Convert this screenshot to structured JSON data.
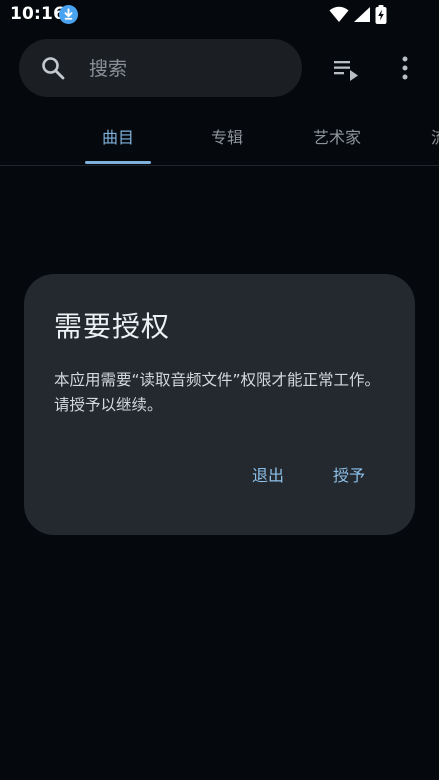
{
  "status_bar": {
    "time": "10:16"
  },
  "search": {
    "placeholder": "搜索"
  },
  "tabs": [
    {
      "label": "曲目",
      "active": true
    },
    {
      "label": "专辑",
      "active": false
    },
    {
      "label": "艺术家",
      "active": false
    },
    {
      "label": "流",
      "active": false
    }
  ],
  "dialog": {
    "title": "需要授权",
    "message": "本应用需要“读取音频文件”权限才能正常工作。请授予以继续。",
    "exit_label": "退出",
    "grant_label": "授予"
  },
  "colors": {
    "background": "#05090d",
    "surface": "#24292f",
    "search_bar": "#1b1f24",
    "accent": "#7fb1dc",
    "download_badge": "#4aa3f0"
  },
  "icons": {
    "status": [
      "download-icon",
      "wifi-icon",
      "cell-signal-icon",
      "battery-charging-icon"
    ],
    "toolbar": [
      "search-icon",
      "queue-music-icon",
      "more-vert-icon"
    ]
  }
}
